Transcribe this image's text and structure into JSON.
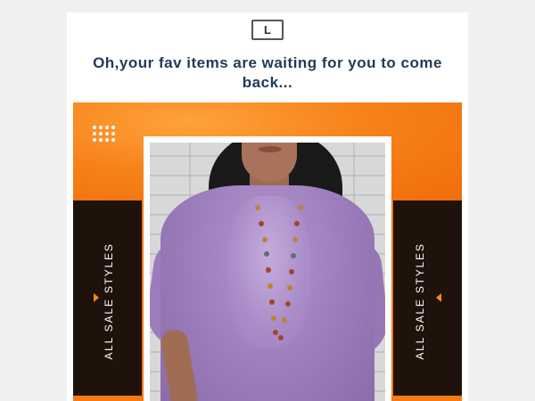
{
  "email": {
    "logo_letter": "L",
    "headline": "Oh,your fav items are waiting for you to come back..."
  },
  "banner": {
    "left_label": "ALL SALE STYLES",
    "right_label": "ALL SALE STYLES",
    "accent_color": "#f57a12",
    "panel_color": "#1e120b",
    "product_color": "#9b7cbb"
  },
  "icons": {
    "decor_dots": "dots-grid-icon",
    "left_arrow": "triangle-right-icon",
    "right_arrow": "triangle-left-icon"
  }
}
